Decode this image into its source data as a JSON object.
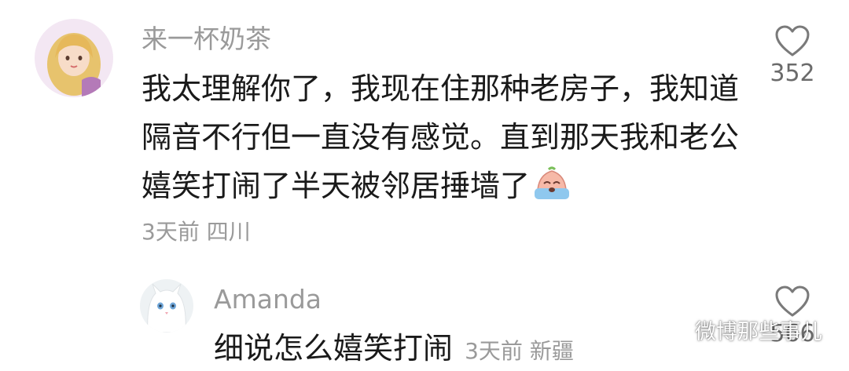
{
  "colors": {
    "text_primary": "#1a1a1a",
    "text_secondary": "#9a9a9a",
    "like_icon": "#7a7a7a",
    "background": "#ffffff"
  },
  "comment": {
    "username": "来一杯奶茶",
    "text": "我太理解你了，我现在住那种老房子，我知道隔音不行但一直没有感觉。直到那天我和老公嬉笑打闹了半天被邻居捶墙了",
    "emoji": "crying-face-emoji",
    "time": "3天前",
    "location": "四川",
    "likes": "352",
    "like_icon": "heart-outline-icon"
  },
  "reply": {
    "username": "Amanda",
    "text": "细说怎么嬉笑打闹",
    "time": "3天前",
    "location": "新疆",
    "likes": "566",
    "like_icon": "heart-outline-icon"
  },
  "watermark": {
    "text": "微博那些事儿",
    "icon": "wechat-icon"
  }
}
